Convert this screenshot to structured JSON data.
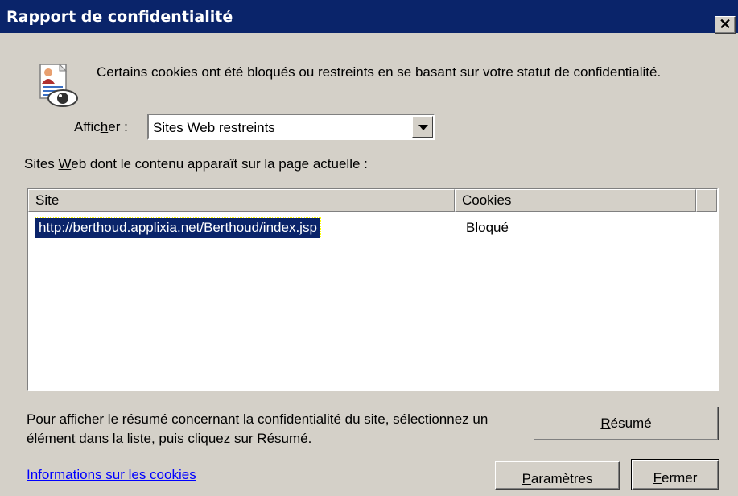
{
  "window": {
    "title": "Rapport de confidentialité",
    "close_symbol": "✕"
  },
  "message": "Certains cookies ont été bloqués ou restreints en se basant sur votre statut de confidentialité.",
  "filter": {
    "label_pre": "Affic",
    "label_mnemonic": "h",
    "label_post": "er :",
    "selected": "Sites Web restreints"
  },
  "sites_label": {
    "pre": "Sites ",
    "mnemonic": "W",
    "post": "eb dont le contenu apparaît sur la page actuelle :"
  },
  "list": {
    "columns": [
      "Site",
      "Cookies"
    ],
    "rows": [
      {
        "site": "http://berthoud.applixia.net/Berthoud/index.jsp",
        "cookies": "Bloqué",
        "selected": true
      }
    ]
  },
  "summary_text": "Pour afficher le résumé concernant la confidentialité du site, sélectionnez un élément dans la liste, puis cliquez sur Résumé.",
  "buttons": {
    "resume": {
      "mnemonic": "R",
      "rest": "ésumé"
    },
    "parametres": {
      "mnemonic": "P",
      "rest": "aramètres"
    },
    "fermer": {
      "mnemonic": "F",
      "rest": "ermer"
    }
  },
  "link": "Informations sur les cookies",
  "icons": {
    "privacy": "privacy-report-icon",
    "dropdown": "chevron-down-icon",
    "close": "close-icon"
  },
  "colors": {
    "titlebar": "#0a246a",
    "face": "#d4d0c8",
    "selection": "#0a246a",
    "link": "#0000ff"
  }
}
